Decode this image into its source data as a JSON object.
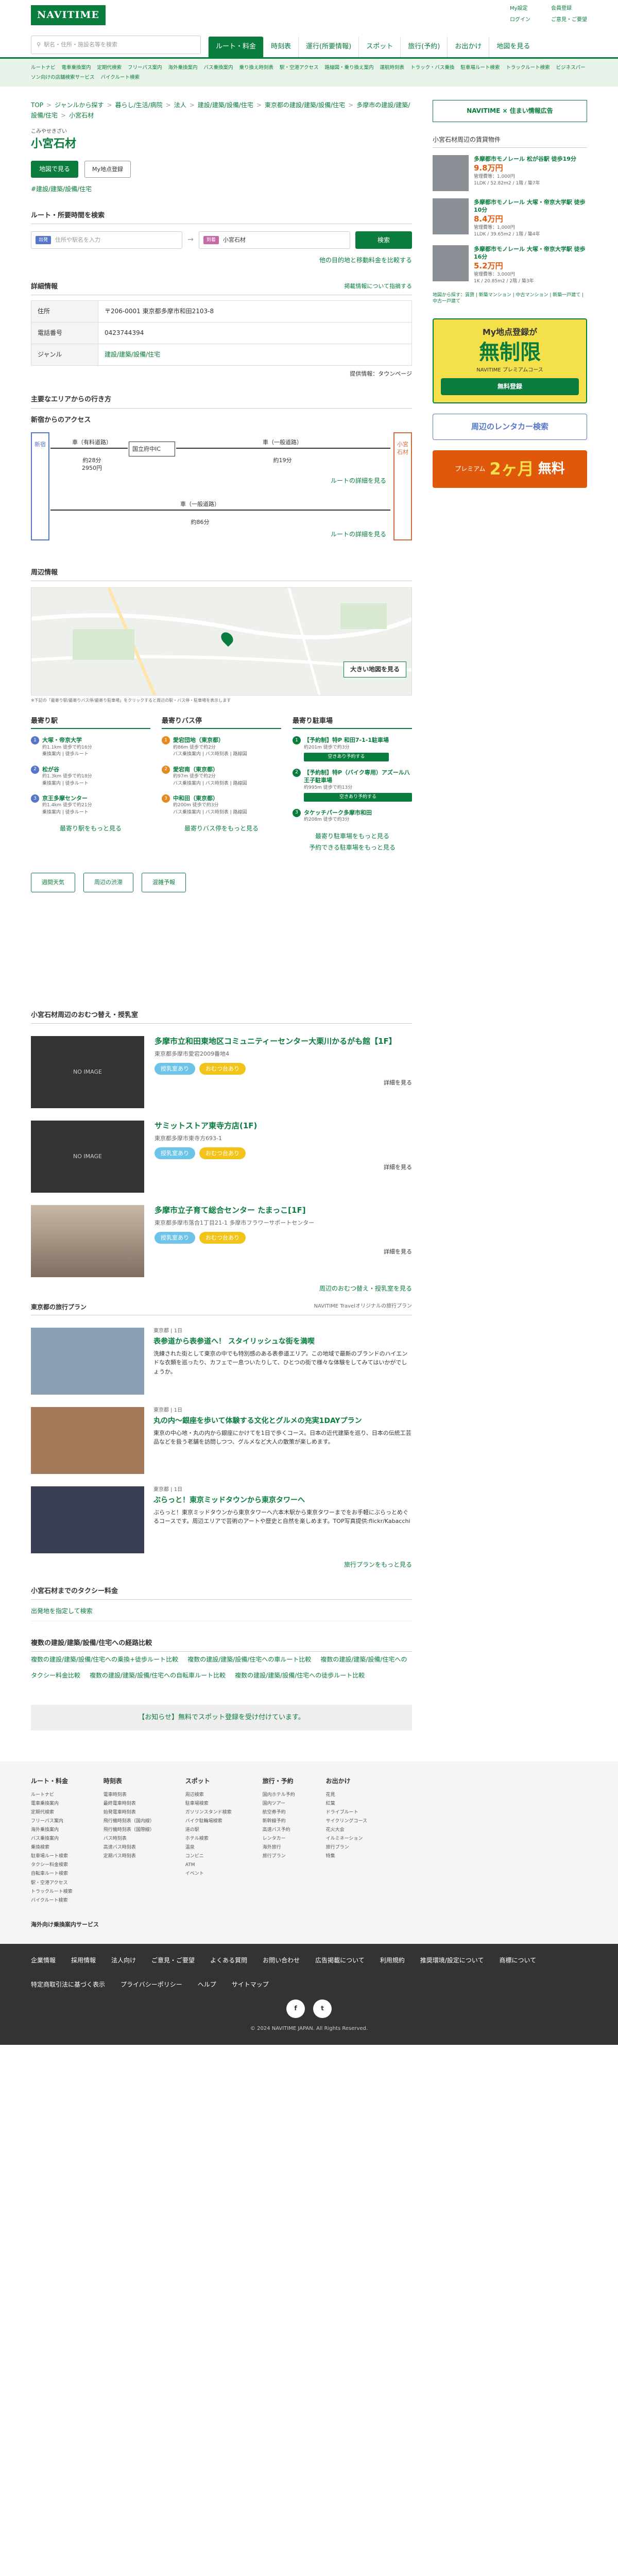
{
  "header": {
    "logo": "NAVITIME",
    "links": [
      "My設定",
      "ログイン",
      "会員登録",
      "ご意見・ご要望"
    ],
    "search_placeholder": "駅名・住所・施設名等を検索",
    "tabs": [
      "ルート・料金",
      "時刻表",
      "運行(所要情報)",
      "スポット",
      "旅行(予約)",
      "お出かけ",
      "地図を見る"
    ],
    "subnav": [
      "ルートナビ",
      "電車乗換案内",
      "定期代検索",
      "フリーパス案内",
      "海外乗換案内",
      "バス乗換案内",
      "乗り換え時刻表",
      "駅・空港アクセス",
      "路線図・乗り換え案内",
      "運航時刻表",
      "トラック・バス乗換",
      "駐車場ルート検索",
      "トラックルート検索",
      "ビジネスパーソン向けの店舗検索サービス",
      "バイクルート検索"
    ]
  },
  "breadcrumb": [
    "TOP",
    "ジャンルから探す",
    "暮らし/生活/病院",
    "法人",
    "建設/建築/設備/住宅",
    "東京都の建設/建築/設備/住宅",
    "多摩市の建設/建築/設備/住宅",
    "小宮石材"
  ],
  "place": {
    "kana": "こみやせきざい",
    "name": "小宮石材",
    "btn_map": "地図で見る",
    "btn_save": "My地点登録",
    "genre_link": "#建設/建築/設備/住宅"
  },
  "route": {
    "heading": "ルート・所要時間を検索",
    "from_tag": "出発",
    "from_placeholder": "住所や駅名を入力",
    "to_tag": "到着",
    "to_value": "小宮石材",
    "search": "検索",
    "more": "他の目的地と移動料金を比較する"
  },
  "info": {
    "heading": "詳細情報",
    "report": "掲載情報について指摘する",
    "rows": [
      {
        "k": "住所",
        "v": "〒206-0001 東京都多摩市和田2103-8"
      },
      {
        "k": "電話番号",
        "v": "0423744394"
      },
      {
        "k": "ジャンル",
        "v": "建設/建築/設備/住宅"
      }
    ],
    "provided": "提供情報：タウンページ"
  },
  "access": {
    "heading": "主要なエリアからの行き方",
    "sub": "新宿からのアクセス",
    "start": "新宿",
    "end": "小宮石材",
    "r1_mode": "車（有料道路）",
    "r1_time": "約28分",
    "r1_fee": "2950円",
    "r1_mid": "国立府中IC",
    "r1_mode2": "車（一般道路）",
    "r1_time2": "約19分",
    "r1_link": "ルートの詳細を見る",
    "r2_mode": "車（一般道路）",
    "r2_time": "約86分",
    "r2_link": "ルートの詳細を見る"
  },
  "map": {
    "heading": "周辺情報",
    "zoom": "大きい地図を見る",
    "note": "※下記の「最寄り駅/最寄りバス停/最寄り駐車場」をクリックすると周辺の駅・バス停・駐車場を表示します"
  },
  "near": {
    "stations_h": "最寄り駅",
    "stations": [
      {
        "n": "大塚・帝京大学",
        "d": "約1.1km 徒歩で約16分",
        "s": "乗換案内 | 徒歩ルート"
      },
      {
        "n": "松が谷",
        "d": "約1.3km 徒歩で約18分",
        "s": "乗換案内 | 徒歩ルート"
      },
      {
        "n": "京王多摩センター",
        "d": "約1.4km 徒歩で約21分",
        "s": "乗換案内 | 徒歩ルート"
      }
    ],
    "stations_more": "最寄り駅をもっと見る",
    "bus_h": "最寄りバス停",
    "bus": [
      {
        "n": "愛宕団地（東京都）",
        "d": "約86m 徒歩で約2分",
        "s": "バス乗換案内 | バス時刻表 | 路線図"
      },
      {
        "n": "愛宕南（東京都）",
        "d": "約97m 徒歩で約2分",
        "s": "バス乗換案内 | バス時刻表 | 路線図"
      },
      {
        "n": "中和田（東京都）",
        "d": "約200m 徒歩で約3分",
        "s": "バス乗換案内 | バス時刻表 | 路線図"
      }
    ],
    "bus_more": "最寄りバス停をもっと見る",
    "park_h": "最寄り駐車場",
    "parks": [
      {
        "n": "【予約制】特P 和田7-1-1駐車場",
        "d": "約201m 徒歩で約3分",
        "s": "空きあり予約する"
      },
      {
        "n": "【予約制】特P（バイク専用）アズール八王子駐車場",
        "d": "約995m 徒歩で約13分",
        "s": "空きあり予約する"
      },
      {
        "n": "タケッチパーク多摩市和田",
        "d": "約208m 徒歩で約3分",
        "s": ""
      }
    ],
    "park_more": "最寄り駐車場をもっと見る",
    "park_more2": "予約できる駐車場をもっと見る"
  },
  "buttons3": [
    "週間天気",
    "周辺の渋滞",
    "混雑予報"
  ],
  "spots": {
    "heading": "小宮石材周辺のおむつ替え・授乳室",
    "items": [
      {
        "name": "多摩市立和田東地区コミュニティーセンター大栗川かるがも館【1F】",
        "addr": "東京都多摩市愛宕2009番地4",
        "img": "NO IMAGE",
        "tags": [
          "授乳室あり",
          "おむつ台あり"
        ]
      },
      {
        "name": "サミットストア東寺方店(1F)",
        "addr": "東京都多摩市東寺方693-1",
        "img": "NO IMAGE",
        "tags": [
          "授乳室あり",
          "おむつ台あり"
        ]
      },
      {
        "name": "多摩市立子育て総合センター たまっこ[1F]",
        "addr": "東京都多摩市落合1丁目21-1 多摩市フラワーサポートセンター",
        "img": "",
        "tags": [
          "授乳室あり",
          "おむつ台あり"
        ]
      }
    ],
    "detail": "詳細を見る",
    "more": "周辺のおむつ替え・授乳室を見る"
  },
  "plans": {
    "heading": "東京都の旅行プラン",
    "src": "NAVITIME Travelオリジナルの旅行プラン",
    "items": [
      {
        "date": "東京都 | 1日",
        "title": "表参道から表参道へ！ スタイリッシュな街を満喫",
        "body": "洗練された街として東京の中でも特別感のある表参道エリア。この地域で最新のブランドのハイエンドな衣類を巡ったり、カフェで一息ついたりして、ひとつの街で様々な体験をしてみてはいかがでしょうか。"
      },
      {
        "date": "東京都 | 1日",
        "title": "丸の内〜銀座を歩いて体験する文化とグルメの充実1DAYプラン",
        "body": "東京の中心地・丸の内から銀座にかけてを1日で歩くコース。日本の近代建築を巡り、日本の伝統工芸品などを扱う老舗を訪問しつつ、グルメなど大人の散策が楽しめます。"
      },
      {
        "date": "東京都 | 1日",
        "title": "ぶらっと！東京ミッドタウンから東京タワーへ",
        "body": "ぶらっと！東京ミッドタウンから東京タワーへ六本木駅から東京タワーまでをお手軽にぶらっとめぐるコースです。周辺エリアで芸術のアートや歴史と自然を楽しめます。TOP写真提供:flickr/Kabacchi"
      }
    ],
    "more": "旅行プランをもっと見る"
  },
  "taxi": {
    "heading": "小宮石材までのタクシー料金",
    "link": "出発地を指定して検索"
  },
  "compare": {
    "heading": "複数の建設/建築/設備/住宅への経路比較",
    "links": [
      "複数の建設/建築/設備/住宅への乗換+徒歩ルート比較",
      "複数の建設/建築/設備/住宅への車ルート比較",
      "複数の建設/建築/設備/住宅へのタクシー料金比較",
      "複数の建設/建築/設備/住宅への自転車ルート比較",
      "複数の建設/建築/設備/住宅への徒歩ルート比較"
    ]
  },
  "notice": "【お知らせ】無料でスポット登録を受け付けています。",
  "side": {
    "rent_btn": "NAVITIME × 住まい情報広告",
    "rent_h": "小宮石材周辺の賃貸物件",
    "rents": [
      {
        "t": "多摩都市モノレール 松が谷駅 徒歩19分",
        "p": "9.8万円",
        "n": "管理費等：1,000円",
        "d": "1LDK / 52.82m2 / 1階 / 築7年"
      },
      {
        "t": "多摩都市モノレール 大塚・帝京大学駅 徒歩10分",
        "p": "8.4万円",
        "n": "管理費等：1,000円",
        "d": "1LDK / 39.65m2 / 1階 / 築4年"
      },
      {
        "t": "多摩都市モノレール 大塚・帝京大学駅 徒歩16分",
        "p": "5.2万円",
        "n": "管理費等：3,000円",
        "d": "1K / 20.85m2 / 2階 / 築3年"
      }
    ],
    "rent_links": "地図から探す：賃貸 | 新築マンション | 中古マンション | 新築一戸建て | 中古一戸建て",
    "ad1_title": "My地点登録が",
    "ad1_big": "無制限",
    "ad1_sub": "NAVITIME プレミアムコース",
    "ad1_btn": "無料登録",
    "ad2": "周辺のレンタカー検索",
    "ad3_a": "プレミアム",
    "ad3_b": "2ヶ月",
    "ad3_c": "無料"
  },
  "footer": {
    "cols": [
      {
        "h": "ルート・料金",
        "items": [
          "ルートナビ",
          "電車乗換案内",
          "定期代検索",
          "フリーパス案内",
          "海外乗換案内",
          "バス乗換案内",
          "乗換検索",
          "駐車場ルート検索",
          "タクシー料金検索",
          "自転車ルート検索",
          "駅・空港アクセス",
          "トラックルート検索",
          "バイクルート検索"
        ]
      },
      {
        "h": "時刻表",
        "items": [
          "電車時刻表",
          "最終電車時刻表",
          "始発電車時刻表",
          "飛行機時刻表（国内線）",
          "飛行機時刻表（国際線）",
          "バス時刻表",
          "高速バス時刻表",
          "定期バス時刻表"
        ]
      },
      {
        "h": "スポット",
        "items": [
          "周辺検索",
          "駐車場検索",
          "ガソリンスタンド検索",
          "バイク駐輪場検索",
          "道の駅",
          "ホテル検索",
          "温泉",
          "コンビニ",
          "ATM",
          "イベント"
        ]
      },
      {
        "h": "旅行・予約",
        "items": [
          "国内ホテル予約",
          "国内ツアー",
          "航空券予約",
          "新幹線予約",
          "高速バス予約",
          "レンタカー",
          "海外旅行",
          "旅行プラン"
        ]
      },
      {
        "h": "お出かけ",
        "items": [
          "花見",
          "紅葉",
          "ドライブルート",
          "サイクリングコース",
          "花火大会",
          "イルミネーション",
          "旅行プラン",
          "特集"
        ]
      }
    ],
    "travel_h": "海外向け乗換案内サービス",
    "dark": [
      "企業情報",
      "採用情報",
      "法人向け",
      "ご意見・ご要望",
      "よくある質問",
      "お問い合わせ",
      "広告掲載について",
      "利用規約",
      "推奨環境/設定について",
      "商標について",
      "特定商取引法に基づく表示",
      "プライバシーポリシー",
      "ヘルプ",
      "サイトマップ"
    ],
    "copy": "© 2024 NAVITIME JAPAN. All Rights Reserved."
  }
}
